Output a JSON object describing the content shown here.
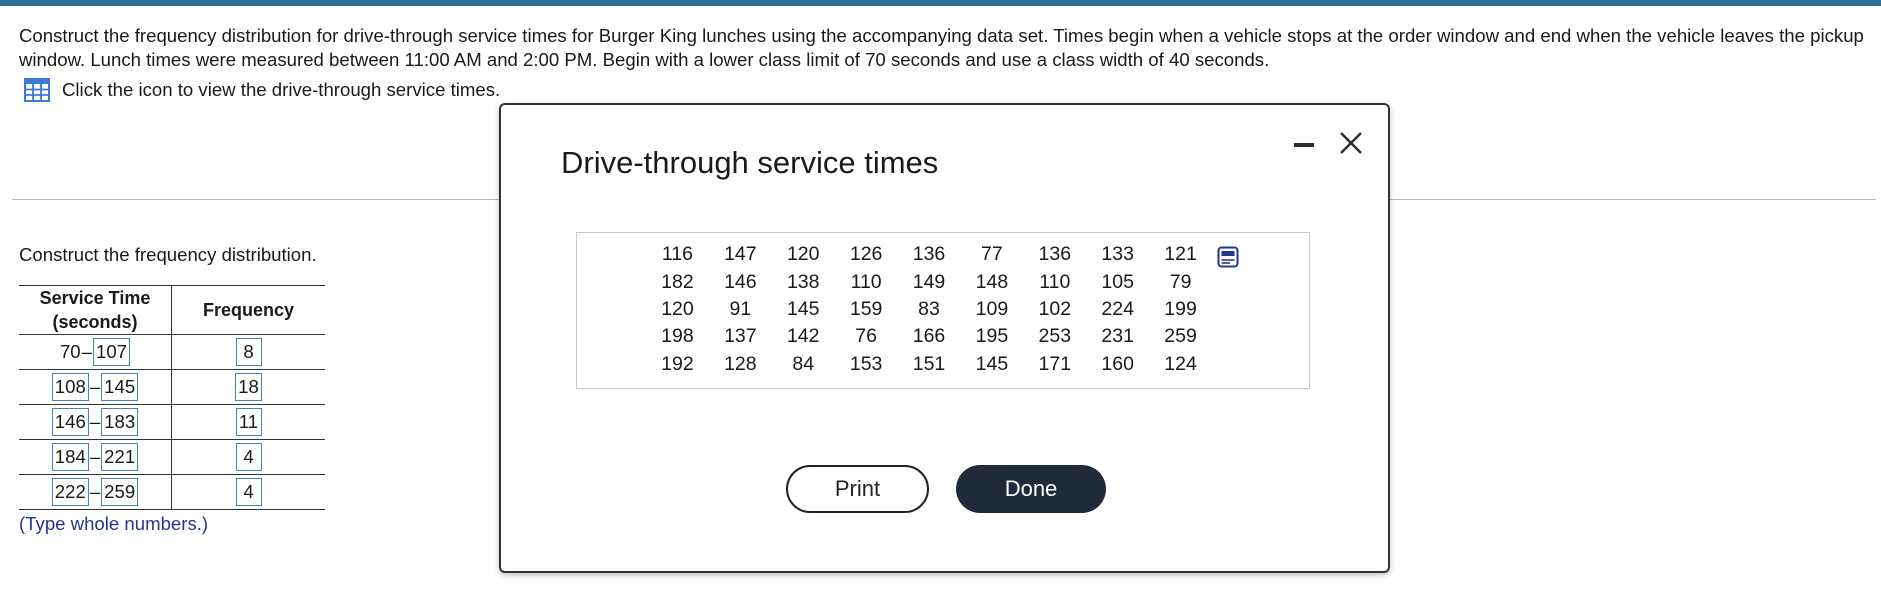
{
  "question": {
    "text": "Construct the frequency distribution for drive-through service times for Burger King lunches using the accompanying data set. Times begin when a vehicle stops at the order window and end when the vehicle leaves the pickup window. Lunch times were measured between 11:00 AM and 2:00 PM. Begin with a lower class limit of 70 seconds and use a class width of 40 seconds.",
    "hint": "Click the icon to view the drive-through service times.",
    "hint_icon": "table-grid-icon"
  },
  "answer": {
    "instruction": "Construct the frequency distribution.",
    "col_headers": [
      "Service Time (seconds)",
      "Frequency"
    ],
    "rows": [
      {
        "lower": "70",
        "upper": "107",
        "frequency": "8"
      },
      {
        "lower": "108",
        "upper": "145",
        "frequency": "18"
      },
      {
        "lower": "146",
        "upper": "183",
        "frequency": "11"
      },
      {
        "lower": "184",
        "upper": "221",
        "frequency": "4"
      },
      {
        "lower": "222",
        "upper": "259",
        "frequency": "4"
      }
    ],
    "dash": "–",
    "note": "(Type whole numbers.)"
  },
  "modal": {
    "title": "Drive-through service times",
    "minimize_icon": "minimize-icon",
    "close_icon": "close-icon",
    "copy_icon": "copy-data-icon",
    "times": [
      [
        "116",
        "147",
        "120",
        "126",
        "136",
        "77",
        "136",
        "133",
        "121"
      ],
      [
        "182",
        "146",
        "138",
        "110",
        "149",
        "148",
        "110",
        "105",
        "79"
      ],
      [
        "120",
        "91",
        "145",
        "159",
        "83",
        "109",
        "102",
        "224",
        "199"
      ],
      [
        "198",
        "137",
        "142",
        "76",
        "166",
        "195",
        "253",
        "231",
        "259"
      ],
      [
        "192",
        "128",
        "84",
        "153",
        "151",
        "145",
        "171",
        "160",
        "124"
      ]
    ],
    "print_label": "Print",
    "done_label": "Done"
  },
  "colors": {
    "top_bar": "#2f6f95",
    "input_border": "#4b7fb8",
    "note_text": "#24378f",
    "done_button": "#212a3a",
    "grid_icon": "#3a7bd5"
  }
}
